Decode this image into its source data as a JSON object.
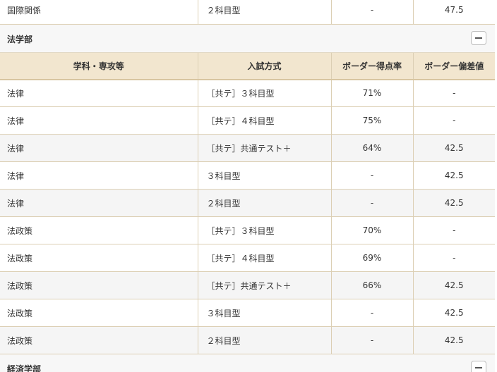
{
  "top_row": {
    "dept": "国際関係",
    "method": "２科目型",
    "rate": "-",
    "hensa": "47.5"
  },
  "law": {
    "title": "法学部",
    "headers": {
      "dept": "学科・専攻等",
      "method": "入試方式",
      "rate": "ボーダー得点率",
      "hensa": "ボーダー偏差値"
    },
    "rows": [
      {
        "dept": "法律",
        "method": "［共テ］３科目型",
        "rate": "71%",
        "hensa": "-"
      },
      {
        "dept": "法律",
        "method": "［共テ］４科目型",
        "rate": "75%",
        "hensa": "-"
      },
      {
        "dept": "法律",
        "method": "［共テ］共通テスト＋",
        "rate": "64%",
        "hensa": "42.5"
      },
      {
        "dept": "法律",
        "method": "３科目型",
        "rate": "-",
        "hensa": "42.5"
      },
      {
        "dept": "法律",
        "method": "２科目型",
        "rate": "-",
        "hensa": "42.5"
      },
      {
        "dept": "法政策",
        "method": "［共テ］３科目型",
        "rate": "70%",
        "hensa": "-"
      },
      {
        "dept": "法政策",
        "method": "［共テ］４科目型",
        "rate": "69%",
        "hensa": "-"
      },
      {
        "dept": "法政策",
        "method": "［共テ］共通テスト＋",
        "rate": "66%",
        "hensa": "42.5"
      },
      {
        "dept": "法政策",
        "method": "３科目型",
        "rate": "-",
        "hensa": "42.5"
      },
      {
        "dept": "法政策",
        "method": "２科目型",
        "rate": "-",
        "hensa": "42.5"
      }
    ]
  },
  "next_section": {
    "title": "経済学部"
  },
  "icons": {
    "collapse": "minus-icon"
  }
}
